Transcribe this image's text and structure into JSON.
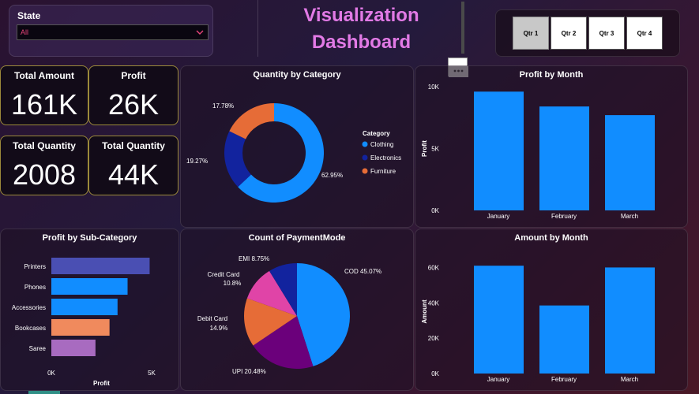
{
  "filter": {
    "label": "State",
    "value": "All"
  },
  "title": {
    "line1": "Visualization",
    "line2": "Dashboard"
  },
  "quarters": [
    "Qtr 1",
    "Qtr 2",
    "Qtr 3",
    "Qtr 4"
  ],
  "kpis": [
    {
      "title": "Total Amount",
      "value": "161K"
    },
    {
      "title": "Profit",
      "value": "26K"
    },
    {
      "title": "Total Quantity",
      "value": "2008"
    },
    {
      "title": "Total Quantity",
      "value": "44K"
    }
  ],
  "colors": {
    "blue": "#118dff",
    "navy": "#12239e",
    "orange": "#e66c37",
    "purple": "#6b007b",
    "pink": "#e044a7",
    "slate": "#4a4fb3",
    "salmon": "#f08a5d",
    "lilac": "#a86bc0",
    "title_pink": "#e27ae6"
  },
  "chart_data": [
    {
      "type": "pie",
      "title": "Quantity by Category",
      "legend_title": "Category",
      "legend_position": "right",
      "categories": [
        "Clothing",
        "Electronics",
        "Furniture"
      ],
      "values": [
        62.95,
        19.27,
        17.78
      ],
      "labels": [
        "62.95%",
        "19.27%",
        "17.78%"
      ]
    },
    {
      "type": "bar",
      "title": "Profit by Month",
      "ylabel": "Profit",
      "categories": [
        "January",
        "February",
        "March"
      ],
      "values": [
        9600,
        8400,
        7700
      ],
      "ylim": [
        0,
        10000
      ],
      "yticks": [
        "0K",
        "5K",
        "10K"
      ]
    },
    {
      "type": "bar",
      "orientation": "horizontal",
      "title": "Profit by Sub-Category",
      "xlabel": "Profit",
      "categories": [
        "Printers",
        "Phones",
        "Accessories",
        "Bookcases",
        "Saree"
      ],
      "values": [
        4900,
        3800,
        3300,
        2900,
        2200
      ],
      "xlim": [
        0,
        5000
      ],
      "xticks": [
        "0K",
        "5K"
      ]
    },
    {
      "type": "pie",
      "title": "Count of PaymentMode",
      "categories": [
        "COD",
        "UPI",
        "Debit Card",
        "Credit Card",
        "EMI"
      ],
      "values": [
        45.07,
        20.48,
        14.9,
        10.8,
        8.75
      ],
      "labels": [
        "COD 45.07%",
        "UPI 20.48%",
        "Debit Card",
        "14.9%",
        "Credit Card",
        "10.8%",
        "EMI 8.75%"
      ]
    },
    {
      "type": "bar",
      "title": "Amount by Month",
      "ylabel": "Amount",
      "categories": [
        "January",
        "February",
        "March"
      ],
      "values": [
        61000,
        38500,
        60000
      ],
      "ylim": [
        0,
        70000
      ],
      "yticks": [
        "0K",
        "20K",
        "40K",
        "60K"
      ]
    }
  ]
}
